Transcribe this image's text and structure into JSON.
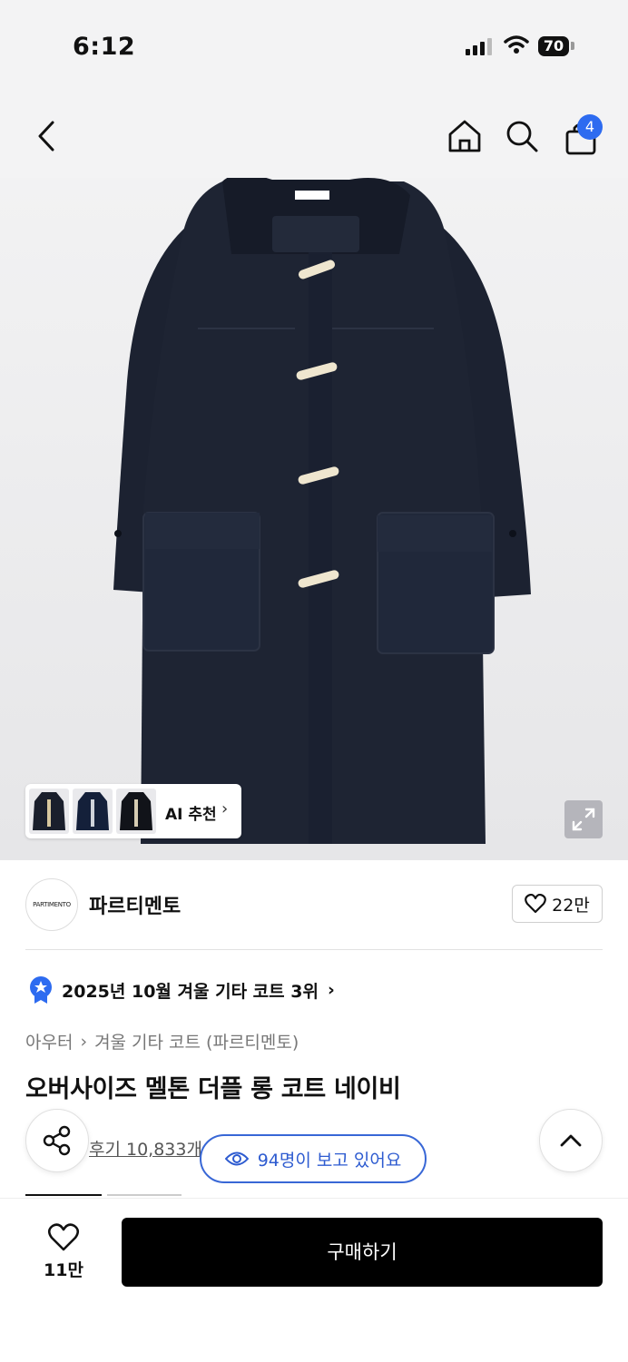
{
  "status_bar": {
    "time": "6:12",
    "battery": "70"
  },
  "nav": {
    "cart_count": "4"
  },
  "hero": {
    "ai_recommend_label": "AI 추천",
    "chevron": "›"
  },
  "brand": {
    "logo_text": "PARTIMENTO",
    "name": "파르티멘토",
    "likes": "22만"
  },
  "ranking": {
    "text": "2025년 10월 겨울 기타 코트 3위",
    "chevron": "›"
  },
  "breadcrumb": {
    "category": "아우터",
    "separator": "›",
    "subcategory": "겨울 기타 코트 (파르티멘토)"
  },
  "product": {
    "title": "오버사이즈 멜톤 더플 롱 코트 네이비",
    "reviews": "후기 10,833개",
    "viewers": "94명이 보고 있어요"
  },
  "bottom_bar": {
    "wish_count": "11만",
    "buy_label": "구매하기"
  },
  "colors": {
    "accent": "#2d6bf0",
    "viewer_blue": "#3867d6",
    "coat_navy": "#1c2231",
    "toggle": "#efe6cf"
  }
}
